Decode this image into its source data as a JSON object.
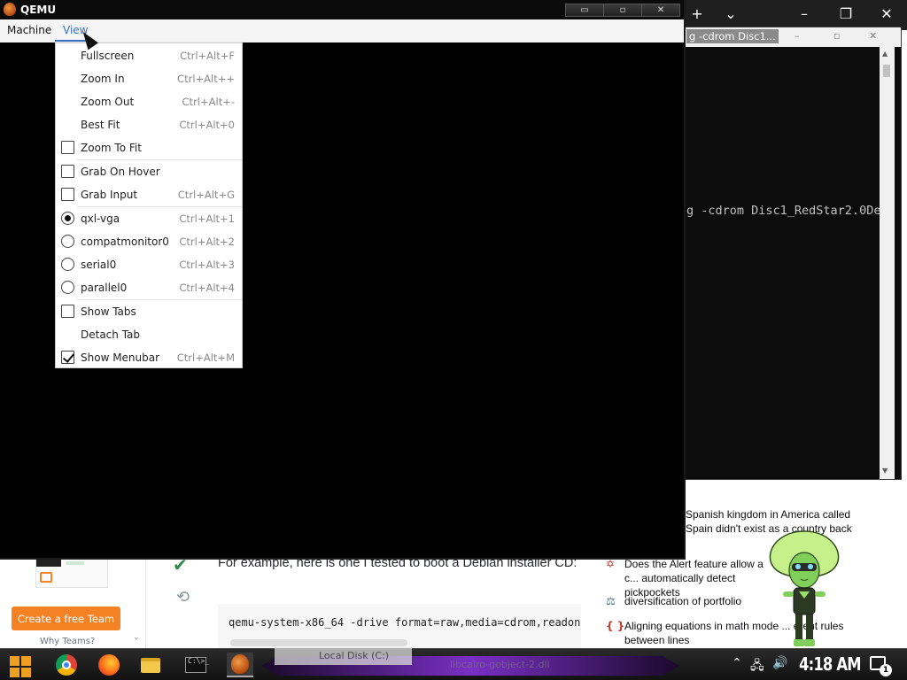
{
  "qemu": {
    "title": "QEMU",
    "controls": {
      "minimize": "▭",
      "maximize": "▫",
      "close": "✕"
    },
    "menubar": {
      "machine": "Machine",
      "view": "View"
    },
    "view_menu": {
      "fullscreen": {
        "label": "Fullscreen",
        "shortcut": "Ctrl+Alt+F"
      },
      "zoom_in": {
        "label": "Zoom In",
        "shortcut": "Ctrl+Alt++"
      },
      "zoom_out": {
        "label": "Zoom Out",
        "shortcut": "Ctrl+Alt+-"
      },
      "best_fit": {
        "label": "Best Fit",
        "shortcut": "Ctrl+Alt+0"
      },
      "zoom_to_fit": {
        "label": "Zoom To Fit",
        "checked": false
      },
      "grab_on_hover": {
        "label": "Grab On Hover",
        "checked": false
      },
      "grab_input": {
        "label": "Grab Input",
        "shortcut": "Ctrl+Alt+G",
        "checked": false
      },
      "qxl_vga": {
        "label": "qxl-vga",
        "shortcut": "Ctrl+Alt+1",
        "selected": true
      },
      "compatmonitor0": {
        "label": "compatmonitor0",
        "shortcut": "Ctrl+Alt+2",
        "selected": false
      },
      "serial0": {
        "label": "serial0",
        "shortcut": "Ctrl+Alt+3",
        "selected": false
      },
      "parallel0": {
        "label": "parallel0",
        "shortcut": "Ctrl+Alt+4",
        "selected": false
      },
      "show_tabs": {
        "label": "Show Tabs",
        "checked": false
      },
      "detach_tab": {
        "label": "Detach Tab"
      },
      "show_menubar": {
        "label": "Show Menubar",
        "shortcut": "Ctrl+Alt+M",
        "checked": true
      }
    }
  },
  "terminal": {
    "title": "g -cdrom Disc1...",
    "controls": {
      "minimize": "–",
      "maximize": "▫",
      "close": "✕"
    },
    "line": "g -cdrom Disc1_RedStar2.0De"
  },
  "browser": {
    "controls": {
      "new_tab": "+",
      "dropdown": "⌄",
      "minimize": "–",
      "maximize": "❐",
      "close": "✕"
    },
    "answer_text": "For example, here is one I tested to boot a Debian installer CD:",
    "code": "qemu-system-x86_64 -drive format=raw,media=cdrom,readon",
    "create_team_button": "Create a free Team",
    "why_teams": "Why Teams?",
    "hot_questions": {
      "q0": "?",
      "q1": "Spanish kingdom in America called Spain didn't exist as a country back",
      "q2": "Does the Alert feature allow a c... automatically detect pickpockets",
      "q3": "diversification of portfolio",
      "q4": "Aligning equations in math mode ... erent rules between lines"
    }
  },
  "taskbar": {
    "local_disk": "Local Disk (C:)",
    "libcairo": "libcairo-gobject-2.dll",
    "cmd_text": "C:\\>_",
    "clock": "4:18 AM",
    "notification_count": "1"
  },
  "colors": {
    "accent_blue": "#3a6fc4",
    "so_orange": "#f48225",
    "taskbar_purple": "#7a2fc5"
  },
  "icons": [
    "qemu-logo-icon",
    "check-icon",
    "history-icon",
    "chrome-icon",
    "firefox-icon",
    "folder-icon",
    "cmd-icon",
    "network-icon",
    "volume-icon",
    "notification-icon"
  ]
}
